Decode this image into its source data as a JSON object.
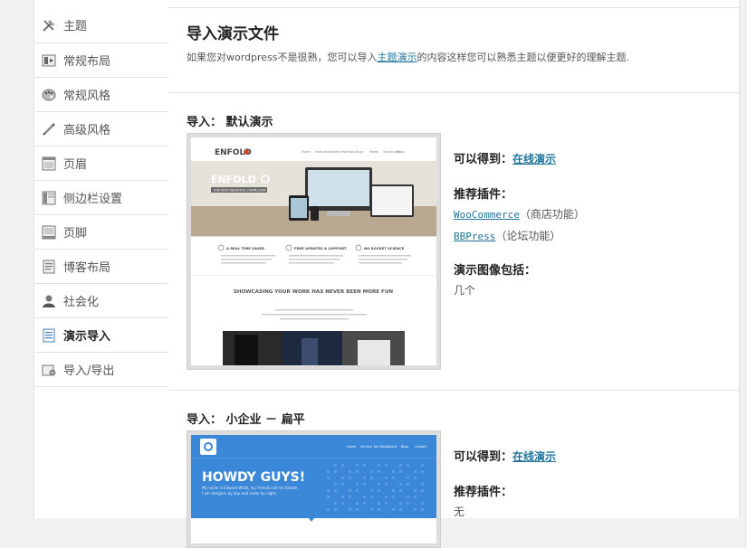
{
  "sidebar": {
    "items": [
      {
        "label": "主题",
        "icon": "tools-icon"
      },
      {
        "label": "常规布局",
        "icon": "layout-icon"
      },
      {
        "label": "常规风格",
        "icon": "palette-icon"
      },
      {
        "label": "高级风格",
        "icon": "brush-icon"
      },
      {
        "label": "页眉",
        "icon": "header-icon"
      },
      {
        "label": "侧边栏设置",
        "icon": "sidebar-icon"
      },
      {
        "label": "页脚",
        "icon": "footer-icon"
      },
      {
        "label": "博客布局",
        "icon": "blog-icon"
      },
      {
        "label": "社会化",
        "icon": "user-icon"
      },
      {
        "label": "演示导入",
        "icon": "document-icon"
      },
      {
        "label": "导入/导出",
        "icon": "import-export-icon"
      }
    ],
    "active_index": 9
  },
  "header": {
    "title": "导入演示文件",
    "desc_before": "如果您对wordpress不是很熟，您可以导入",
    "desc_link": "主题演示",
    "desc_after": "的内容这样您可以熟悉主题以便更好的理解主题."
  },
  "demos": [
    {
      "title": "导入：  默认演示",
      "get_label": "可以得到：",
      "live_link": "在线演示",
      "plugins_label": "推荐插件：",
      "plugins": [
        {
          "name": "WooCommerce",
          "note": "（商店功能）"
        },
        {
          "name": "BBPress",
          "note": "（论坛功能）"
        }
      ],
      "images_label": "演示图像包括：",
      "images_value": "几个",
      "thumb": {
        "logo": "ENFOLD",
        "tagline": "OUR MOST BEAUTIFUL THEME EVER",
        "feature1": "A REAL TIME SAVER",
        "feature2": "FREE UPDATES & SUPPORT",
        "feature3": "NO ROCKET SCIENCE",
        "banner": "SHOWCASING YOUR WORK HAS NEVER BEEN MORE FUN",
        "nav": [
          "Home",
          "Features",
          "Headers",
          "Portfolio",
          "Blog",
          "Pages",
          "Shortcodes",
          "Shop"
        ]
      }
    },
    {
      "title": "导入：  小企业 － 扁平",
      "get_label": "可以得到：",
      "live_link": "在线演示",
      "plugins_label": "推荐插件：",
      "plugins_value": "无",
      "thumb": {
        "headline": "HOWDY GUYS!",
        "line1": "My name is Edward Whitt, my friends call me Enfold.",
        "line2": "I am designer by day and coder by night.",
        "nav": [
          "Home",
          "Service",
          "My Work",
          "About",
          "Blog",
          "Contact"
        ]
      }
    }
  ],
  "colors": {
    "link": "#21759b",
    "accent_blue": "#3b87d8",
    "enfold_red": "#c44a3a"
  }
}
